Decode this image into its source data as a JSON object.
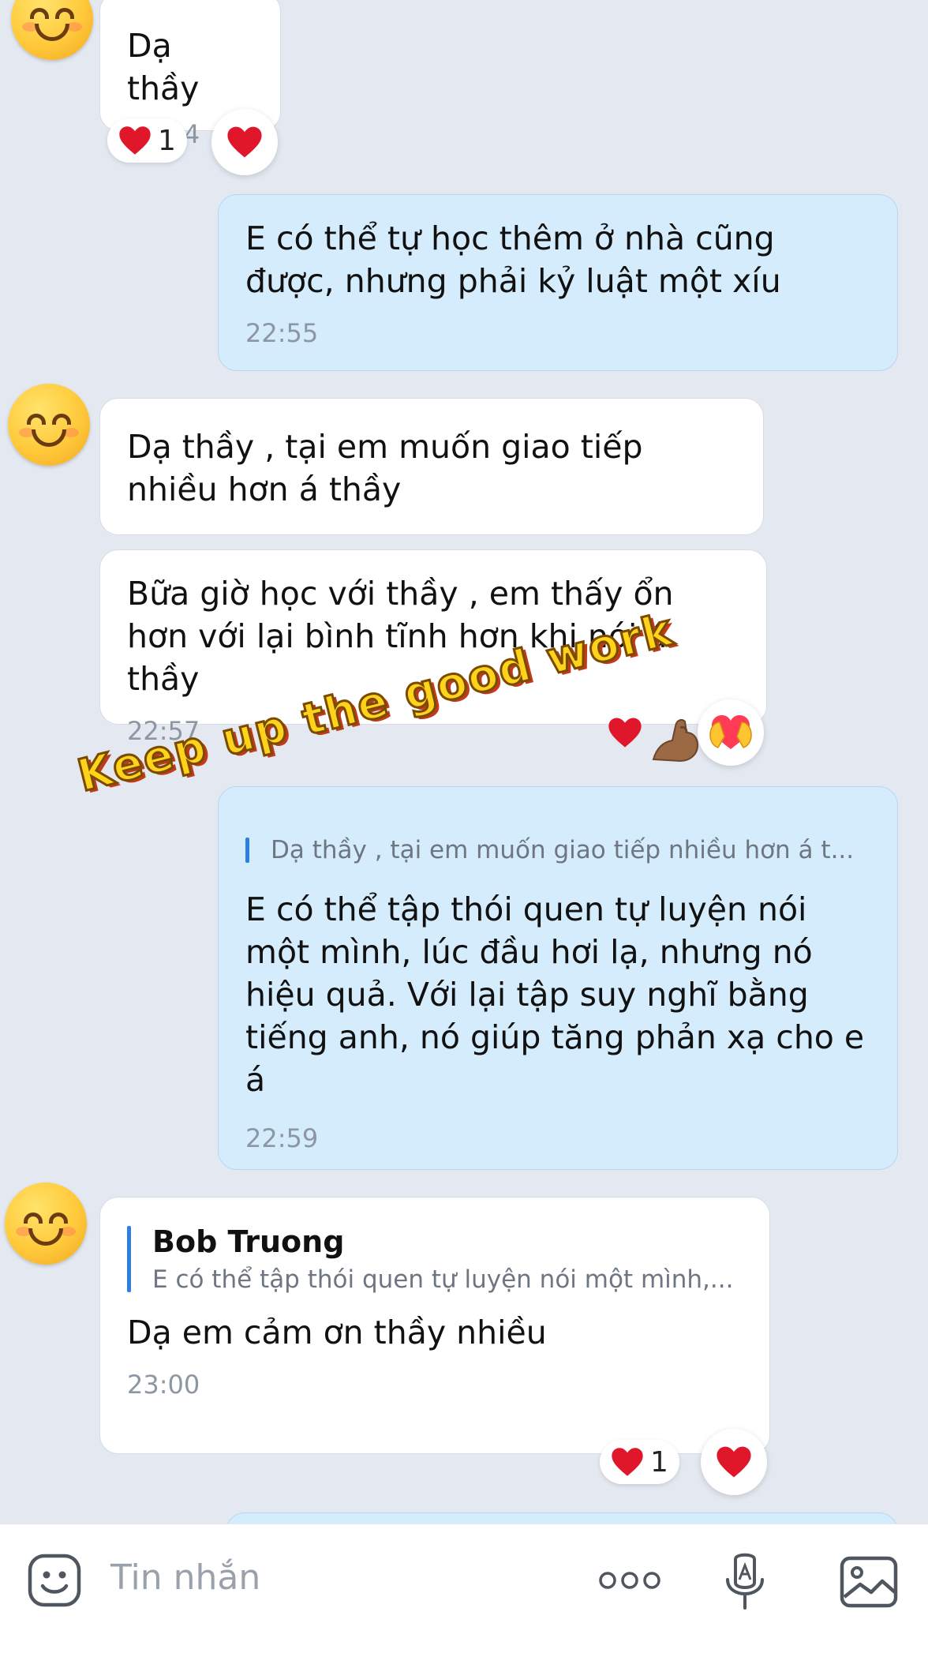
{
  "messages": [
    {
      "id": "m1",
      "direction": "in",
      "text": "Dạ thầy",
      "time": "22:54"
    },
    {
      "id": "m2",
      "direction": "out",
      "text": "E có thể tự học thêm ở nhà cũng được, nhưng phải kỷ luật một xíu",
      "time": "22:55"
    },
    {
      "id": "m3",
      "direction": "in",
      "text": "Dạ thầy , tại em muốn giao tiếp nhiều hơn á thầy",
      "time": ""
    },
    {
      "id": "m4",
      "direction": "in",
      "text": "Bữa giờ học với thầy , em thấy ổn hơn với lại bình tĩnh hơn khi nói á thầy",
      "time": "22:57"
    },
    {
      "id": "m5",
      "direction": "out",
      "quote_text": "Dạ thầy , tại em muốn giao tiếp nhiều hơn á t...",
      "text": "E có thể tập thói quen tự luyện nói một mình, lúc đầu hơi lạ, nhưng nó hiệu quả. Với lại tập suy nghĩ bằng tiếng anh, nó giúp tăng phản xạ cho e á",
      "time": "22:59"
    },
    {
      "id": "m6",
      "direction": "in",
      "quote_author": "Bob Truong",
      "quote_text": "E có thể tập thói quen tự luyện nói một mình,...",
      "text": "Dạ em cảm ơn thầy nhiều",
      "time": "23:00"
    }
  ],
  "reactions": {
    "m1_count": "1",
    "m6_count": "1"
  },
  "sticker": {
    "text": "Keep up the good work"
  },
  "input": {
    "placeholder": "Tin nhắn"
  },
  "icons": {
    "emoji": "emoji-face-icon",
    "more": "more-dots-icon",
    "mic": "voice-mic-icon",
    "image": "image-gallery-icon",
    "heart": "heart-icon"
  },
  "colors": {
    "background": "#e4e8f1",
    "bubble_in": "#ffffff",
    "bubble_out": "#d4ecfc",
    "quote_bar": "#2f7fe0",
    "heart": "#e0162b",
    "time": "#8d96a3"
  }
}
